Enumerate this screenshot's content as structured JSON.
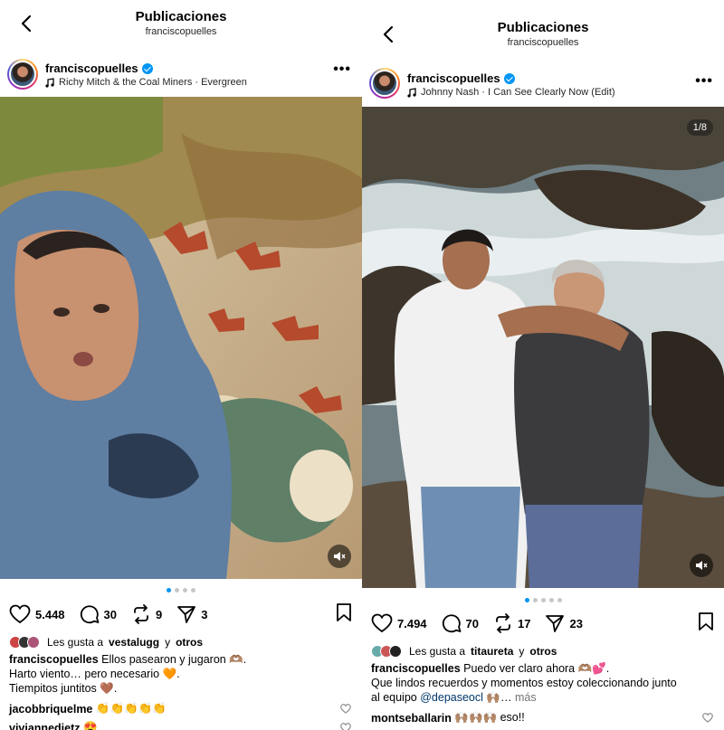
{
  "left": {
    "header": {
      "title": "Publicaciones",
      "subtitle": "franciscopuelles"
    },
    "post": {
      "username": "franciscopuelles",
      "music": "Richy Mitch & the Coal Miners · Evergreen",
      "likes_count": "5.448",
      "comments_count": "30",
      "reposts_count": "9",
      "shares_count": "3",
      "liked_by_prefix": "Les gusta a",
      "liked_by_user": "vestalugg",
      "liked_by_and": "y",
      "liked_by_others": "otros",
      "caption_user": "franciscopuelles",
      "caption_line1": "Ellos pasearon y jugaron 🫶🏽.",
      "caption_line2": "Harto viento… pero necesario 🧡.",
      "caption_line3": "Tiempitos juntitos 🤎.",
      "comment1_user": "jacobbriquelme",
      "comment1_text": "👏👏👏👏👏",
      "comment2_user": "viviannedietz",
      "comment2_text": "😍"
    }
  },
  "right": {
    "header": {
      "title": "Publicaciones",
      "subtitle": "franciscopuelles"
    },
    "post": {
      "username": "franciscopuelles",
      "music": "Johnny Nash · I Can See Clearly Now (Edit)",
      "counter": "1/8",
      "likes_count": "7.494",
      "comments_count": "70",
      "reposts_count": "17",
      "shares_count": "23",
      "liked_by_prefix": "Les gusta a",
      "liked_by_user": "titaureta",
      "liked_by_and": "y",
      "liked_by_others": "otros",
      "caption_user": "franciscopuelles",
      "caption_line1": "Puedo ver claro ahora 🫶🏽💕.",
      "caption_line2": "Que lindos recuerdos y momentos estoy coleccionando junto",
      "caption_line3_prefix": "al equipo",
      "caption_mention": "@depaseocl",
      "caption_line3_suffix": "🙌🏽…",
      "caption_more": "más",
      "comment1_user": "montseballarin",
      "comment1_text": "🙌🏽🙌🏽🙌🏽 eso!!"
    }
  },
  "colors": {
    "accent": "#0095f6",
    "mention": "#00376b",
    "muted": "#737373"
  }
}
